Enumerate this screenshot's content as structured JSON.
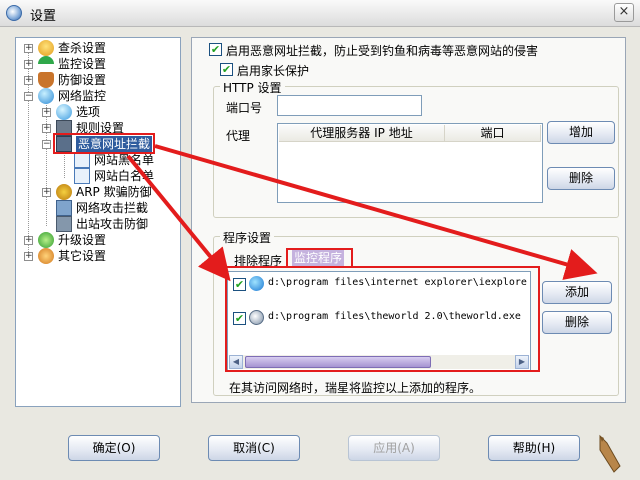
{
  "window": {
    "title": "设置",
    "close_label": "×"
  },
  "tree": {
    "items": [
      {
        "label": "查杀设置",
        "icon": "shield-scan-icon"
      },
      {
        "label": "监控设置",
        "icon": "umbrella-icon"
      },
      {
        "label": "防御设置",
        "icon": "defense-shield-icon"
      },
      {
        "label": "网络监控",
        "icon": "network-globe-icon"
      },
      {
        "label": "选项",
        "icon": "options-globe-icon"
      },
      {
        "label": "规则设置",
        "icon": "rules-icon"
      },
      {
        "label": "恶意网址拦截",
        "icon": "url-block-icon"
      },
      {
        "label": "网站黑名单",
        "icon": "blacklist-icon"
      },
      {
        "label": "网站白名单",
        "icon": "whitelist-icon"
      },
      {
        "label": "ARP 欺骗防御",
        "icon": "arp-icon"
      },
      {
        "label": "网络攻击拦截",
        "icon": "attack-block-icon"
      },
      {
        "label": "出站攻击防御",
        "icon": "outbound-icon"
      },
      {
        "label": "升级设置",
        "icon": "upgrade-icon"
      },
      {
        "label": "其它设置",
        "icon": "other-settings-icon"
      }
    ]
  },
  "panel": {
    "enable_block_label": "启用恶意网址拦截，防止受到钓鱼和病毒等恶意网站的侵害",
    "enable_block_checked": true,
    "parental_label": "启用家长保护",
    "parental_checked": true,
    "http_group_title": "HTTP 设置",
    "port_label": "端口号",
    "port_value": "",
    "proxy_label": "代理",
    "proxy_columns": [
      "代理服务器 IP 地址",
      "端口"
    ],
    "add_proxy_button": "增加",
    "delete_proxy_button": "删除",
    "program_group_title": "程序设置",
    "tab_exclude": "排除程序",
    "tab_monitor": "监控程序",
    "programs": [
      {
        "path": "d:\\program files\\internet explorer\\iexplore.",
        "checked": true,
        "icon": "internet-explorer-icon"
      },
      {
        "path": "d:\\program files\\theworld 2.0\\theworld.exe",
        "checked": true,
        "icon": "theworld-browser-icon"
      }
    ],
    "add_program_button": "添加",
    "delete_program_button": "删除",
    "note": "在其访问网络时，瑞星将监控以上添加的程序。"
  },
  "footer": {
    "ok_button": "确定(O)",
    "cancel_button": "取消(C)",
    "apply_button": "应用(A)",
    "help_button": "帮助(H)"
  },
  "colors": {
    "annotation_red": "#e31c1c",
    "selected_tab": "#c5b2de",
    "tree_highlight": "#2f5c9e"
  }
}
